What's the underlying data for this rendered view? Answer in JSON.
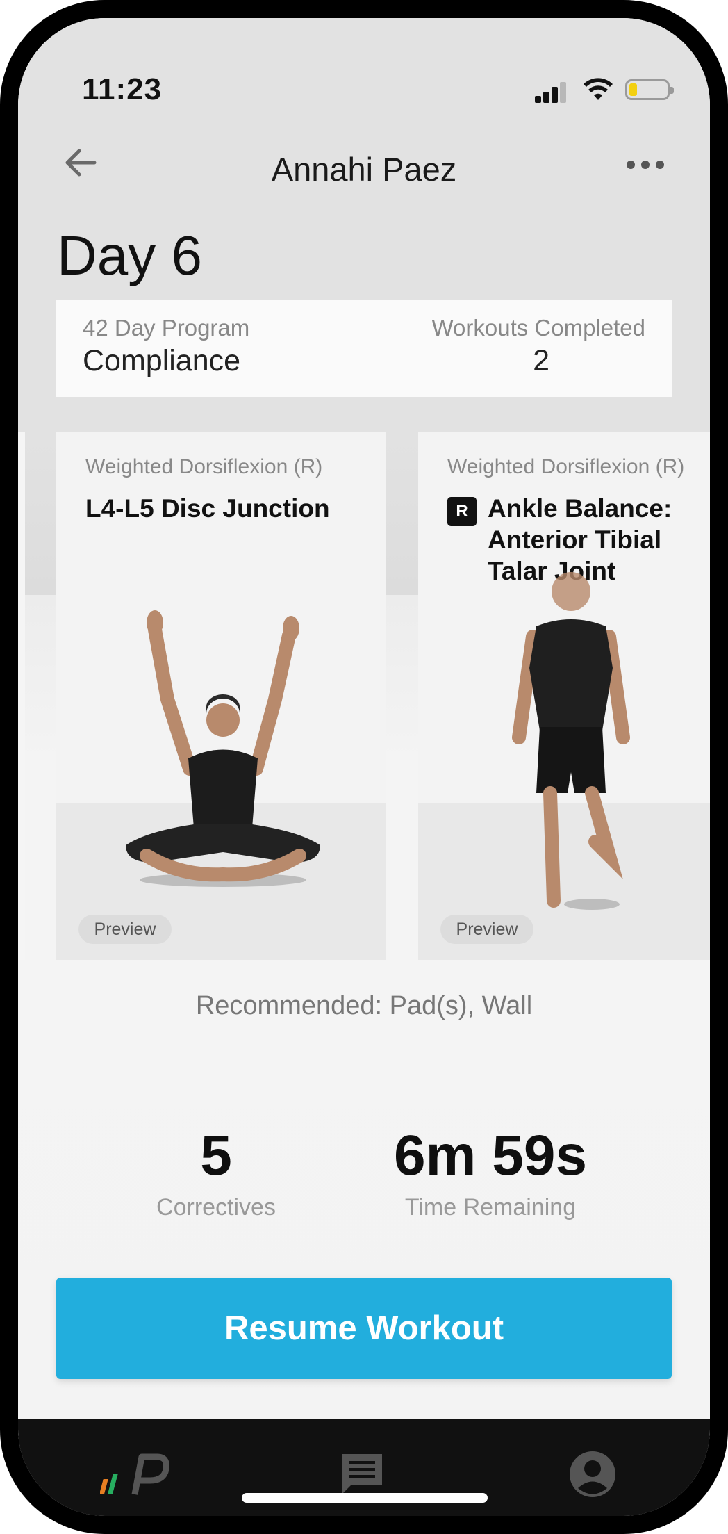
{
  "status_bar": {
    "time": "11:23"
  },
  "header": {
    "title": "Annahi Paez"
  },
  "day_title": "Day 6",
  "program": {
    "program_label": "42 Day Program",
    "compliance_label": "Compliance",
    "workouts_label": "Workouts Completed",
    "workouts_value": "2"
  },
  "cards": [
    {
      "subtitle": "Weighted Dorsiflexion (R)",
      "title": "L4-L5  Disc Junction",
      "preview_label": "Preview"
    },
    {
      "subtitle": "Weighted Dorsiflexion (R)",
      "badge": "R",
      "title_lines": [
        "Ankle Balance:",
        "Anterior Tibial",
        "Talar Joint"
      ],
      "preview_label": "Preview"
    }
  ],
  "recommended": "Recommended: Pad(s), Wall",
  "summary": {
    "correctives_value": "5",
    "correctives_label": "Correctives",
    "time_value": "6m 59s",
    "time_label": "Time Remaining"
  },
  "resume_button": "Resume Workout",
  "tabs": [
    "logo-tab",
    "messages-tab",
    "profile-tab"
  ],
  "colors": {
    "accent": "#22aedd",
    "battery": "#f3d011"
  }
}
